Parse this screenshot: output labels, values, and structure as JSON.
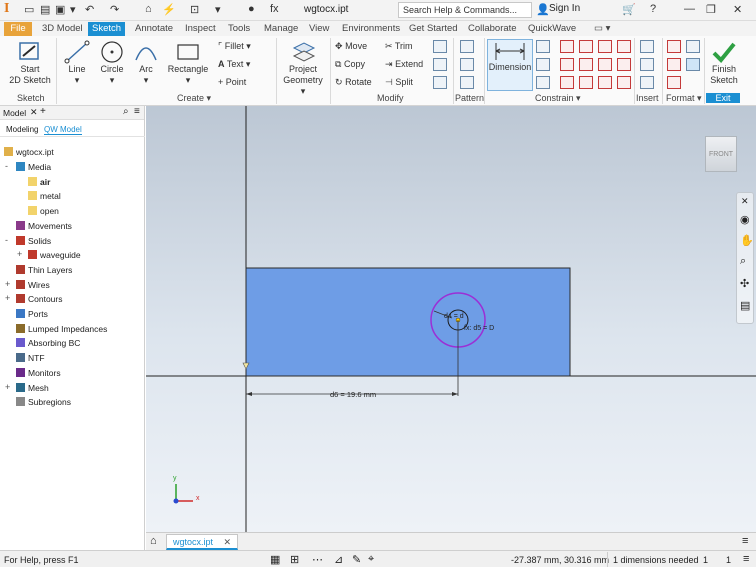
{
  "titlebar": {
    "app_logo": "I",
    "doc_title": "wgtocx.ipt",
    "search_placeholder": "Search Help & Commands...",
    "sign_in": "Sign In"
  },
  "tabs": {
    "file": "File",
    "items": [
      "3D Model",
      "Sketch",
      "Annotate",
      "Inspect",
      "Tools",
      "Manage",
      "View",
      "Environments",
      "Get Started",
      "Collaborate",
      "QuickWave"
    ],
    "active": "Sketch"
  },
  "ribbon": {
    "sketch": {
      "start": "Start",
      "start2": "2D Sketch",
      "panel": "Sketch"
    },
    "create": {
      "line": "Line",
      "circle": "Circle",
      "arc": "Arc",
      "rectangle": "Rectangle",
      "fillet": "Fillet",
      "text": "Text",
      "point": "Point",
      "panel": "Create"
    },
    "project": {
      "label1": "Project",
      "label2": "Geometry"
    },
    "modify": {
      "move": "Move",
      "copy": "Copy",
      "rotate": "Rotate",
      "trim": "Trim",
      "extend": "Extend",
      "split": "Split",
      "panel": "Modify"
    },
    "pattern": {
      "panel": "Pattern"
    },
    "constrain": {
      "dimension": "Dimension",
      "panel": "Constrain"
    },
    "insert": {
      "panel": "Insert"
    },
    "format": {
      "panel": "Format"
    },
    "exit": {
      "finish1": "Finish",
      "finish2": "Sketch",
      "panel": "Exit"
    }
  },
  "browser": {
    "tab_model": "Model",
    "mode_modeling": "Modeling",
    "mode_qw": "QW Model",
    "root": "wgtocx.ipt",
    "items": [
      {
        "label": "Media",
        "level": 1,
        "expander": "-"
      },
      {
        "label": "air",
        "level": 2,
        "expander": "",
        "bold": true
      },
      {
        "label": "metal",
        "level": 2,
        "expander": ""
      },
      {
        "label": "open",
        "level": 2,
        "expander": ""
      },
      {
        "label": "Movements",
        "level": 1,
        "expander": ""
      },
      {
        "label": "Solids",
        "level": 1,
        "expander": "-"
      },
      {
        "label": "waveguide",
        "level": 2,
        "expander": "+"
      },
      {
        "label": "Thin Layers",
        "level": 1,
        "expander": ""
      },
      {
        "label": "Wires",
        "level": 1,
        "expander": "+"
      },
      {
        "label": "Contours",
        "level": 1,
        "expander": "+"
      },
      {
        "label": "Ports",
        "level": 1,
        "expander": ""
      },
      {
        "label": "Lumped Impedances",
        "level": 1,
        "expander": ""
      },
      {
        "label": "Absorbing BC",
        "level": 1,
        "expander": ""
      },
      {
        "label": "NTF",
        "level": 1,
        "expander": ""
      },
      {
        "label": "Monitors",
        "level": 1,
        "expander": ""
      },
      {
        "label": "Mesh",
        "level": 1,
        "expander": "+"
      },
      {
        "label": "Subregions",
        "level": 1,
        "expander": ""
      }
    ]
  },
  "canvas": {
    "viewcube": "FRONT",
    "dim_d6": "d6 = 19.6 mm",
    "dim_d4": "d4 = d",
    "dim_d5": "fx: d5 = D",
    "axis_x": "x",
    "axis_y": "y"
  },
  "doctab": {
    "label": "wgtocx.ipt"
  },
  "status": {
    "help": "For Help, press F1",
    "coords": "-27.387 mm, 30.316 mm",
    "dims_needed": "1 dimensions needed",
    "count1": "1",
    "count2": "1"
  },
  "colors": {
    "accent": "#1b8fd2",
    "file_tab": "#e8a33a",
    "sketch_region": "#6e9de6",
    "circle": "#9b2fd6"
  }
}
